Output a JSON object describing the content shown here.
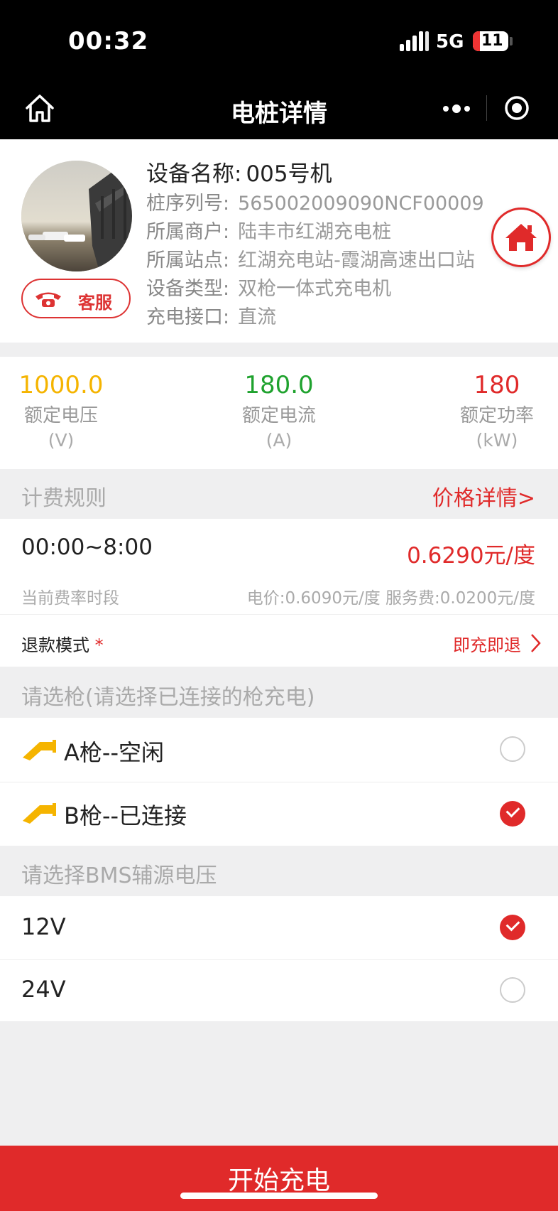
{
  "status_bar": {
    "time": "00:32",
    "network": "5G",
    "battery": "11"
  },
  "nav": {
    "title": "电桩详情"
  },
  "device": {
    "name_label": "设备名称:",
    "name_value": "005号机",
    "service_button": "客服",
    "rows": [
      {
        "key": "桩序列号:",
        "value": "565002009090NCF00009"
      },
      {
        "key": "所属商户:",
        "value": "陆丰市红湖充电桩"
      },
      {
        "key": "所属站点:",
        "value": "红湖充电站-霞湖高速出口站"
      },
      {
        "key": "设备类型:",
        "value": "双枪一体式充电机"
      },
      {
        "key": "充电接口:",
        "value": "直流"
      }
    ]
  },
  "specs": [
    {
      "value": "1000.0",
      "name": "额定电压",
      "unit": "(V)",
      "color": "#f5b400"
    },
    {
      "value": "180.0",
      "name": "额定电流",
      "unit": "(A)",
      "color": "#1fa22e"
    },
    {
      "value": "180",
      "name": "额定功率",
      "unit": "(kW)",
      "color": "#e02a2a"
    }
  ],
  "billing": {
    "title": "计费规则",
    "price_link": "价格详情>",
    "period": "00:00~8:00",
    "price": "0.6290元/度",
    "period_caption": "当前费率时段",
    "breakdown": "电价:0.6090元/度 服务费:0.0200元/度"
  },
  "refund": {
    "label": "退款模式",
    "required_mark": "*",
    "value": "即充即退"
  },
  "gun_section": {
    "title": "请选枪(请选择已连接的枪充电)",
    "options": [
      {
        "label": "A枪--空闲",
        "selected": false
      },
      {
        "label": "B枪--已连接",
        "selected": true
      }
    ]
  },
  "bms_section": {
    "title": "请选择BMS辅源电压",
    "options": [
      {
        "label": "12V",
        "selected": true
      },
      {
        "label": "24V",
        "selected": false
      }
    ]
  },
  "start_button": "开始充电",
  "colors": {
    "accent": "#e02a2a",
    "gun_icon": "#f5b400"
  }
}
